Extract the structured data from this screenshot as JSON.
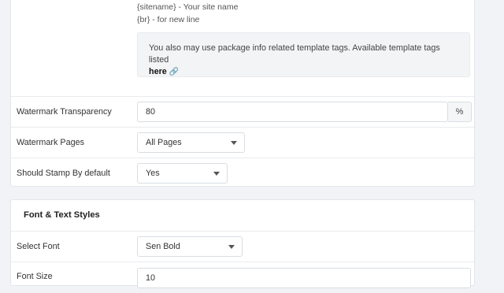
{
  "template_tags": {
    "line1": "{sitename} - Your site name",
    "line2": "{br} - for new line"
  },
  "info": {
    "text": "You also may use package info related template tags. Available template tags listed",
    "link": "here",
    "link_icon": "link-icon"
  },
  "watermark_transparency": {
    "label": "Watermark Transparency",
    "value": "80",
    "unit": "%"
  },
  "watermark_pages": {
    "label": "Watermark Pages",
    "selected": "All Pages"
  },
  "stamp_default": {
    "label": "Should Stamp By default",
    "selected": "Yes"
  },
  "font_section": {
    "title": "Font & Text Styles",
    "select_font": {
      "label": "Select Font",
      "selected": "Sen Bold"
    },
    "font_size": {
      "label": "Font Size",
      "value": "10"
    }
  }
}
